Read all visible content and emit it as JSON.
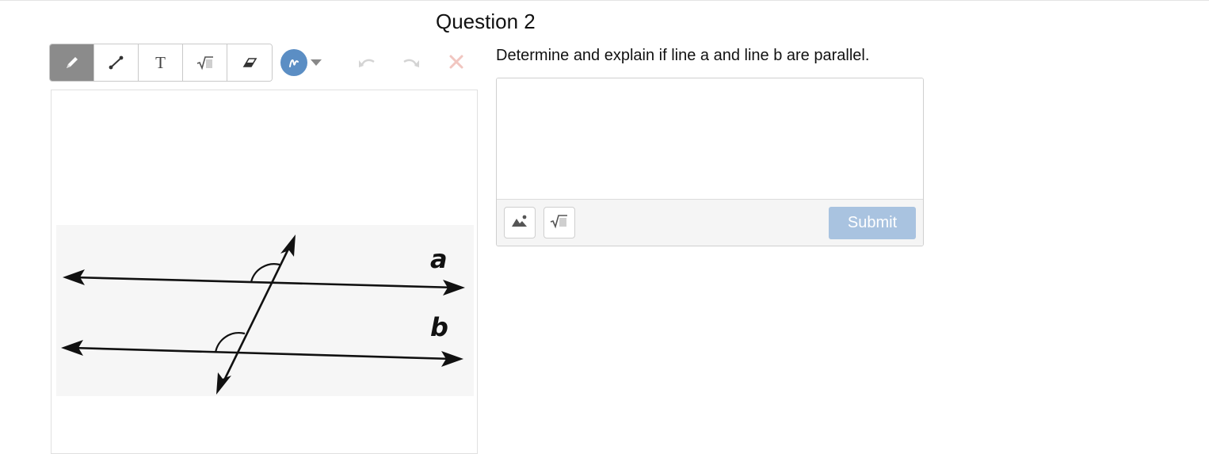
{
  "question": {
    "title": "Question 2",
    "prompt": "Determine and explain if line a and line b are parallel."
  },
  "toolbar": {
    "tools": [
      {
        "name": "pencil",
        "icon": "pencil-icon",
        "active": true
      },
      {
        "name": "line",
        "icon": "line-segment-icon",
        "active": false
      },
      {
        "name": "text",
        "icon": "text-icon",
        "label": "T",
        "active": false
      },
      {
        "name": "math",
        "icon": "square-root-icon",
        "active": false
      },
      {
        "name": "eraser",
        "icon": "eraser-icon",
        "active": false
      }
    ],
    "color": {
      "icon": "pen-color-swatch-icon",
      "value": "#5b8ec4"
    },
    "history": [
      "undo-icon",
      "redo-icon",
      "clear-icon"
    ],
    "text_tool_label": "T"
  },
  "figure": {
    "line_a_label": "a",
    "line_b_label": "b"
  },
  "answer": {
    "value": "",
    "submit_label": "Submit",
    "footer_icons": [
      "insert-image-icon",
      "math-equation-icon"
    ]
  },
  "colors": {
    "accent": "#5b8ec4",
    "submit_disabled": "#a9c3e0",
    "active_tool": "#8b8b8b",
    "clear_x": "#f1c6c0"
  }
}
